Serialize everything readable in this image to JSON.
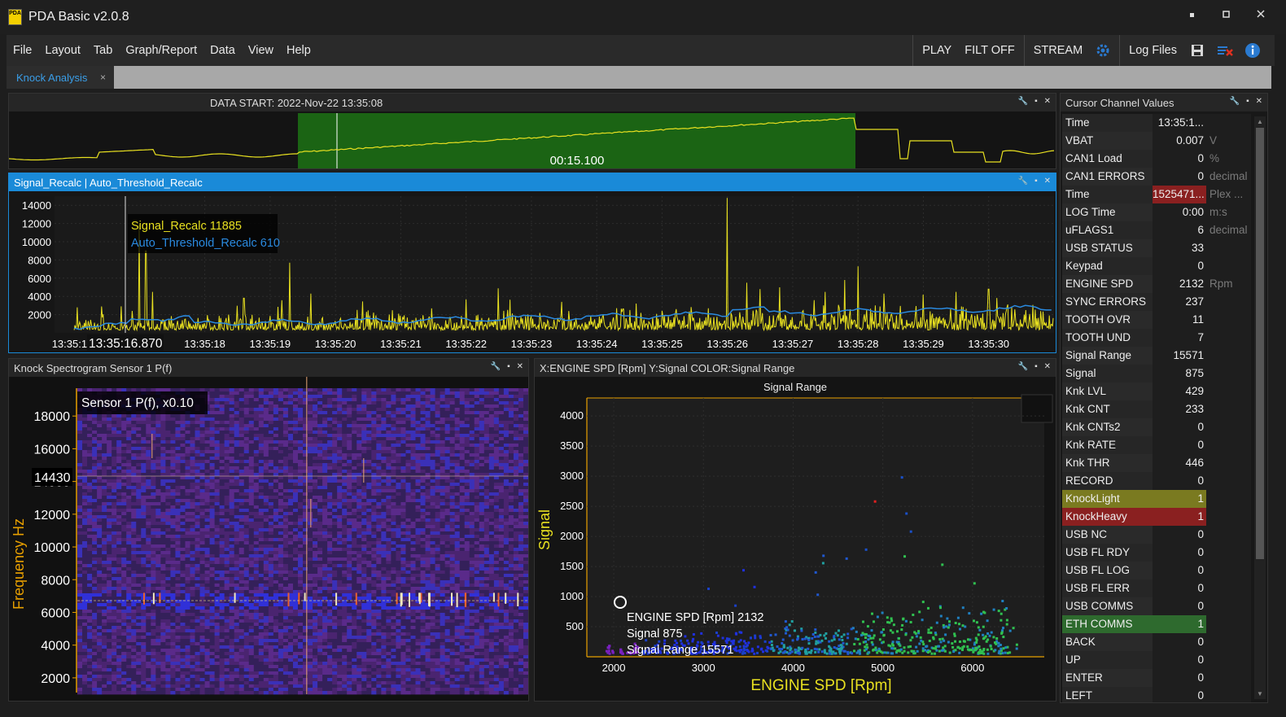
{
  "app": {
    "title": "PDA Basic v2.0.8",
    "logo_text": "PDA"
  },
  "window": {
    "minimize": "▪",
    "maximize": "▪",
    "close": "✕"
  },
  "menu": {
    "items": [
      "File",
      "Layout",
      "Tab",
      "Graph/Report",
      "Data",
      "View",
      "Help"
    ]
  },
  "toolbar": {
    "play": "PLAY",
    "filter": "FILT OFF",
    "stream": "STREAM",
    "log_files": "Log Files"
  },
  "tabs": [
    {
      "label": "Knock Analysis",
      "close": "×"
    }
  ],
  "overview": {
    "title": "DATA START: 2022-Nov-22  13:35:08",
    "selection_duration": "00:15.100"
  },
  "signal_plot": {
    "header": "Signal_Recalc  |  Auto_Threshold_Recalc",
    "cursor_time": "13:35:16.870",
    "first_tick": "13:35:16",
    "legend": [
      {
        "name": "Signal_Recalc",
        "value": "11885",
        "color": "#e8e020"
      },
      {
        "name": "Auto_Threshold_Recalc",
        "value": "610",
        "color": "#2a8ae0"
      }
    ]
  },
  "spectrogram": {
    "header": "Knock Spectrogram Sensor 1 P(f)",
    "label": "Sensor 1 P(f), x0.10",
    "ylabel": "Frequency Hz",
    "cursor_value": "14430",
    "yticks": [
      "18000",
      "16000",
      "12000",
      "10000",
      "8000",
      "6000",
      "4000",
      "2000"
    ]
  },
  "scatter": {
    "header": "X:ENGINE SPD [Rpm]   Y:Signal   COLOR:Signal Range",
    "title": "Signal Range",
    "xlabel": "ENGINE SPD [Rpm]",
    "ylabel": "Signal",
    "tooltip": [
      "ENGINE SPD [Rpm] 2132",
      "Signal 875",
      "Signal Range 15571"
    ]
  },
  "cursor_values": {
    "title": "Cursor Channel Values",
    "rows": [
      {
        "name": "Time",
        "value": "13:35:1...",
        "unit": "",
        "hl": ""
      },
      {
        "name": "VBAT",
        "value": "0.007",
        "unit": "V",
        "hl": ""
      },
      {
        "name": "CAN1 Load",
        "value": "0",
        "unit": "%",
        "hl": ""
      },
      {
        "name": "CAN1 ERRORS",
        "value": "0",
        "unit": "decimal",
        "hl": ""
      },
      {
        "name": "Time",
        "value": "1525471...",
        "unit": "Plex ...",
        "hl": "valred"
      },
      {
        "name": "LOG Time",
        "value": "0:00",
        "unit": "m:s",
        "hl": ""
      },
      {
        "name": "uFLAGS1",
        "value": "6",
        "unit": "decimal",
        "hl": ""
      },
      {
        "name": "USB STATUS",
        "value": "33",
        "unit": "",
        "hl": ""
      },
      {
        "name": "Keypad",
        "value": "0",
        "unit": "",
        "hl": ""
      },
      {
        "name": "ENGINE SPD",
        "value": "2132",
        "unit": "Rpm",
        "hl": ""
      },
      {
        "name": "SYNC ERRORS",
        "value": "237",
        "unit": "",
        "hl": ""
      },
      {
        "name": "TOOTH OVR",
        "value": "11",
        "unit": "",
        "hl": ""
      },
      {
        "name": "TOOTH UND",
        "value": "7",
        "unit": "",
        "hl": ""
      },
      {
        "name": "Signal Range",
        "value": "15571",
        "unit": "",
        "hl": ""
      },
      {
        "name": "Signal",
        "value": "875",
        "unit": "",
        "hl": ""
      },
      {
        "name": "Knk LVL",
        "value": "429",
        "unit": "",
        "hl": ""
      },
      {
        "name": "Knk CNT",
        "value": "233",
        "unit": "",
        "hl": ""
      },
      {
        "name": "Knk CNTs2",
        "value": "0",
        "unit": "",
        "hl": ""
      },
      {
        "name": "Knk RATE",
        "value": "0",
        "unit": "",
        "hl": ""
      },
      {
        "name": "Knk THR",
        "value": "446",
        "unit": "",
        "hl": ""
      },
      {
        "name": "RECORD",
        "value": "0",
        "unit": "",
        "hl": ""
      },
      {
        "name": "KnockLight",
        "value": "1",
        "unit": "",
        "hl": "olive"
      },
      {
        "name": "KnockHeavy",
        "value": "1",
        "unit": "",
        "hl": "red"
      },
      {
        "name": "USB NC",
        "value": "0",
        "unit": "",
        "hl": ""
      },
      {
        "name": "USB FL RDY",
        "value": "0",
        "unit": "",
        "hl": ""
      },
      {
        "name": "USB FL LOG",
        "value": "0",
        "unit": "",
        "hl": ""
      },
      {
        "name": "USB FL ERR",
        "value": "0",
        "unit": "",
        "hl": ""
      },
      {
        "name": "USB COMMS",
        "value": "0",
        "unit": "",
        "hl": ""
      },
      {
        "name": "ETH COMMS",
        "value": "1",
        "unit": "",
        "hl": "green"
      },
      {
        "name": "BACK",
        "value": "0",
        "unit": "",
        "hl": ""
      },
      {
        "name": "UP",
        "value": "0",
        "unit": "",
        "hl": ""
      },
      {
        "name": "ENTER",
        "value": "0",
        "unit": "",
        "hl": ""
      },
      {
        "name": "LEFT",
        "value": "0",
        "unit": "",
        "hl": ""
      }
    ]
  },
  "chart_data": [
    {
      "type": "line",
      "title": "Signal_Recalc | Auto_Threshold_Recalc",
      "x_ticks": [
        "13:35:16",
        "13:35:18",
        "13:35:19",
        "13:35:20",
        "13:35:21",
        "13:35:22",
        "13:35:23",
        "13:35:24",
        "13:35:25",
        "13:35:26",
        "13:35:27",
        "13:35:28",
        "13:35:29",
        "13:35:30"
      ],
      "ylim": [
        0,
        15000
      ],
      "y_ticks": [
        2000,
        4000,
        6000,
        8000,
        10000,
        12000,
        14000
      ],
      "series": [
        {
          "name": "Signal_Recalc",
          "color": "#e8e020",
          "peaks": [
            {
              "t": 17.0,
              "v": 11885
            },
            {
              "t": 17.1,
              "v": 9000
            },
            {
              "t": 17.2,
              "v": 4500
            },
            {
              "t": 18.6,
              "v": 3800
            },
            {
              "t": 19.3,
              "v": 7700
            },
            {
              "t": 26.0,
              "v": 14800
            },
            {
              "t": 26.3,
              "v": 5500
            },
            {
              "t": 26.5,
              "v": 4800
            },
            {
              "t": 26.8,
              "v": 5000
            },
            {
              "t": 27.5,
              "v": 4500
            },
            {
              "t": 27.8,
              "v": 5800
            },
            {
              "t": 28.0,
              "v": 7300
            },
            {
              "t": 28.4,
              "v": 4300
            },
            {
              "t": 29.0,
              "v": 4200
            },
            {
              "t": 29.5,
              "v": 4500
            },
            {
              "t": 30.0,
              "v": 4800
            }
          ]
        },
        {
          "name": "Auto_Threshold_Recalc",
          "color": "#2a8ae0",
          "start": 610,
          "end": 2600
        }
      ]
    },
    {
      "type": "heatmap",
      "title": "Sensor 1 P(f), x0.10",
      "ylabel": "Frequency Hz",
      "ylim": [
        1000,
        19700
      ],
      "y_ticks": [
        2000,
        4000,
        6000,
        8000,
        10000,
        12000,
        14000,
        16000,
        18000
      ],
      "cursor_frequency": 14430,
      "bright_band_hz": 6800
    },
    {
      "type": "scatter",
      "title": "Signal Range",
      "xlabel": "ENGINE SPD [Rpm]",
      "ylabel": "Signal",
      "xlim": [
        1700,
        6800
      ],
      "ylim": [
        0,
        4300
      ],
      "x_ticks": [
        2000,
        3000,
        4000,
        5000,
        6000
      ],
      "y_ticks": [
        500,
        1000,
        1500,
        2000,
        2500,
        3000,
        3500,
        4000
      ],
      "cursor_point": {
        "x": 2132,
        "y": 875,
        "color_value": 15571
      }
    }
  ]
}
